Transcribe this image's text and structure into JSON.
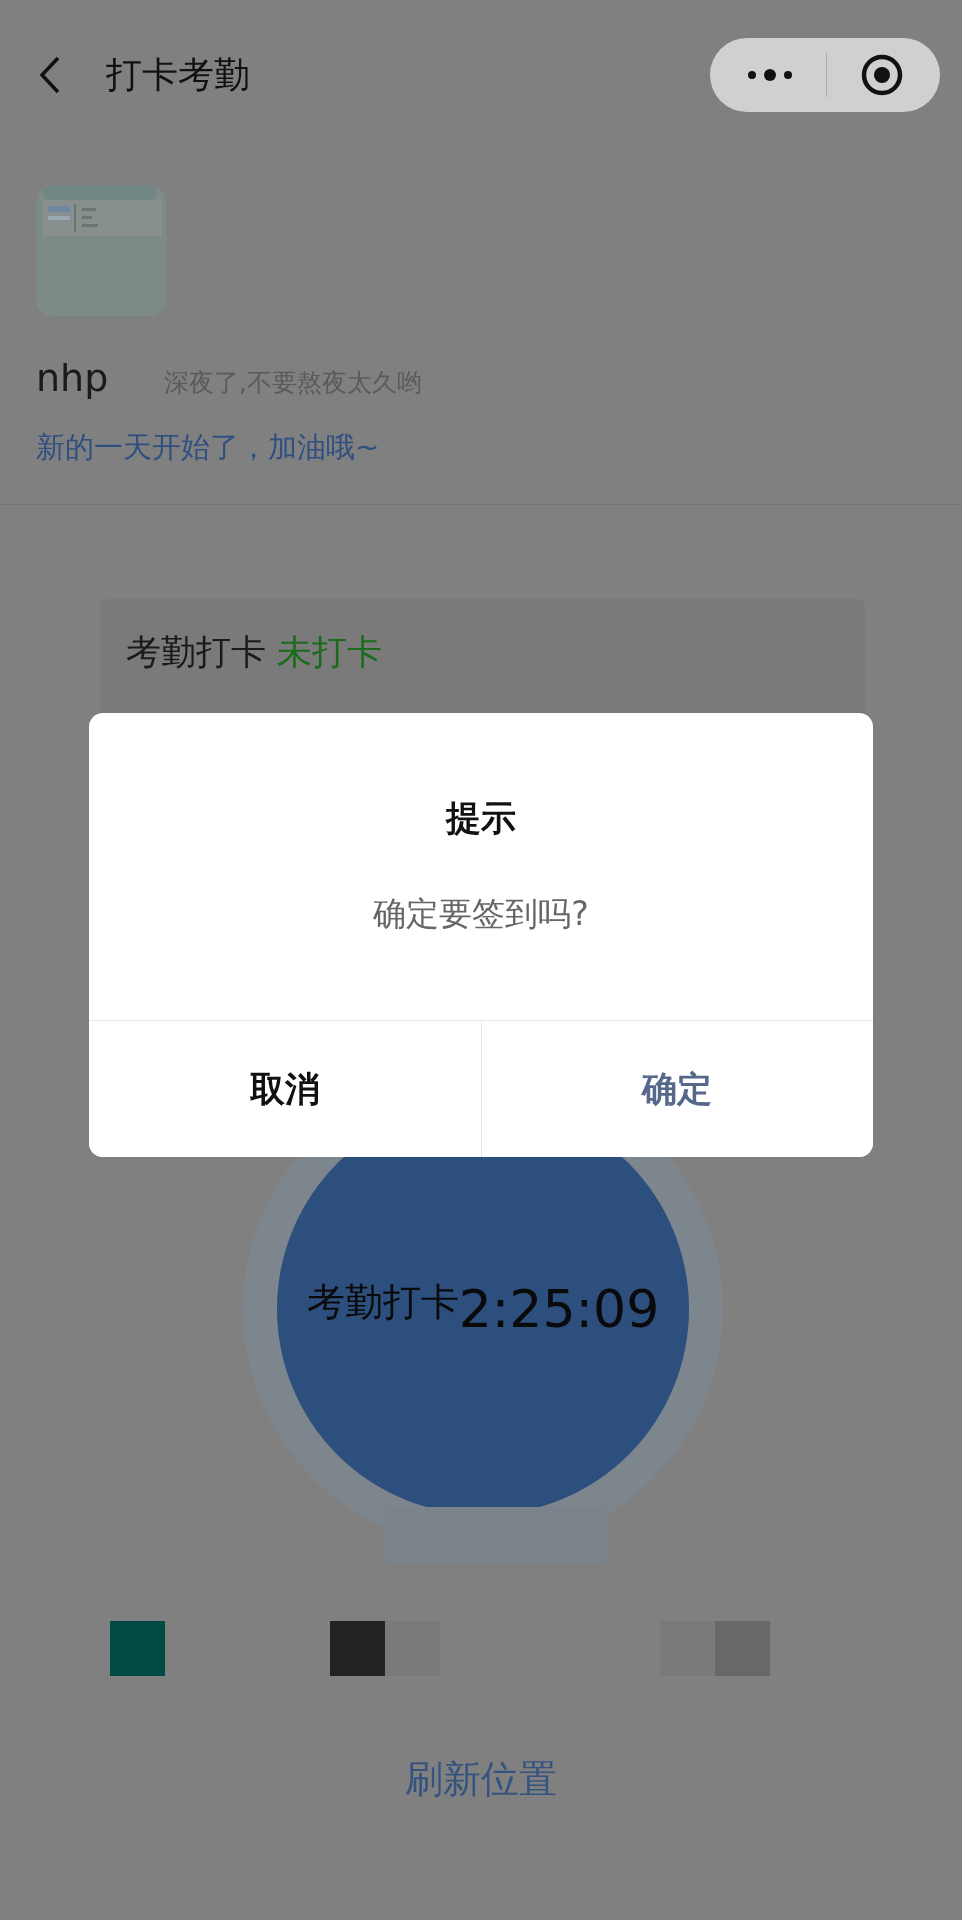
{
  "nav": {
    "title": "打卡考勤"
  },
  "user": {
    "name": "nhp",
    "greeting": "深夜了,不要熬夜太久哟",
    "motto": "新的一天开始了，加油哦~"
  },
  "card": {
    "title": "考勤打卡",
    "status": "未打卡"
  },
  "clock_button": {
    "label": "考勤打卡",
    "time": "2:25:09"
  },
  "refresh_link": "刷新位置",
  "dialog": {
    "title": "提示",
    "message": "确定要签到吗?",
    "buttons": [
      {
        "label": "取消",
        "kind": "cancel"
      },
      {
        "label": "确定",
        "kind": "confirm"
      }
    ]
  }
}
